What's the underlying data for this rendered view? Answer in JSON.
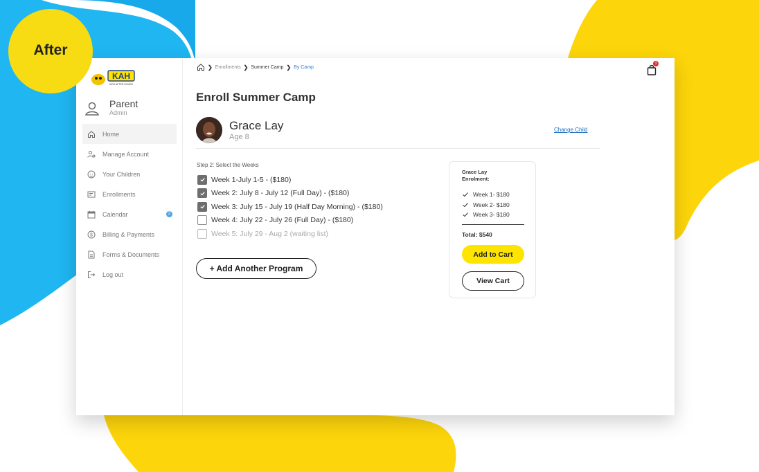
{
  "badge": {
    "label": "After"
  },
  "colors": {
    "accent_yellow": "#ffe400",
    "blue_blob": "#1fb6f2",
    "yellow_blob": "#fdd50b",
    "link_blue": "#1f6fbf",
    "cart_badge_red": "#e02a2a"
  },
  "logo": {
    "text": "KAH",
    "subtext": "KIDS AFTER HOURS"
  },
  "user": {
    "name": "Parent",
    "role": "Admin",
    "icon": "user-icon"
  },
  "sidebar": {
    "items": [
      {
        "label": "Home",
        "icon": "home-icon",
        "active": true
      },
      {
        "label": "Manage Account",
        "icon": "manage-account-icon"
      },
      {
        "label": "Your Children",
        "icon": "children-icon"
      },
      {
        "label": "Enrollments",
        "icon": "enrollments-icon"
      },
      {
        "label": "Calendar",
        "icon": "calendar-icon",
        "badge": "2"
      },
      {
        "label": "Billing & Payments",
        "icon": "dollar-icon"
      },
      {
        "label": "Forms & Documents",
        "icon": "document-icon"
      },
      {
        "label": "Log out",
        "icon": "logout-icon"
      }
    ]
  },
  "breadcrumb": {
    "items": [
      "Enrollments",
      "Summer Camp",
      "By Camp"
    ]
  },
  "cart": {
    "count": "3"
  },
  "page": {
    "title": "Enroll Summer Camp"
  },
  "child": {
    "name": "Grace Lay",
    "age": "Age 8",
    "change_label": "Change Child"
  },
  "step": {
    "label": "Step 2: Select the Weeks"
  },
  "weeks": [
    {
      "label": "Week 1-July 1-5 - ($180)",
      "checked": true
    },
    {
      "label": "Week 2: July 8 - July 12 (Full Day) - ($180)",
      "checked": true
    },
    {
      "label": "Week 3: July 15 - July 19 (Half Day Morning) - ($180)",
      "checked": true
    },
    {
      "label": "Week 4: July 22 - July 26 (Full Day) - ($180)",
      "checked": false
    },
    {
      "label": "Week 5: July 29 - Aug 2 (waiting list)",
      "checked": false,
      "disabled": true
    }
  ],
  "add_program": {
    "label": "+ Add Another Program"
  },
  "summary": {
    "title_line1": "Grace Lay",
    "title_line2": "Enrolment:",
    "items": [
      "Week 1- $180",
      "Week 2- $180",
      "Week 3- $180"
    ],
    "total": "Total: $540",
    "add_to_cart": "Add to Cart",
    "view_cart": "View Cart"
  }
}
